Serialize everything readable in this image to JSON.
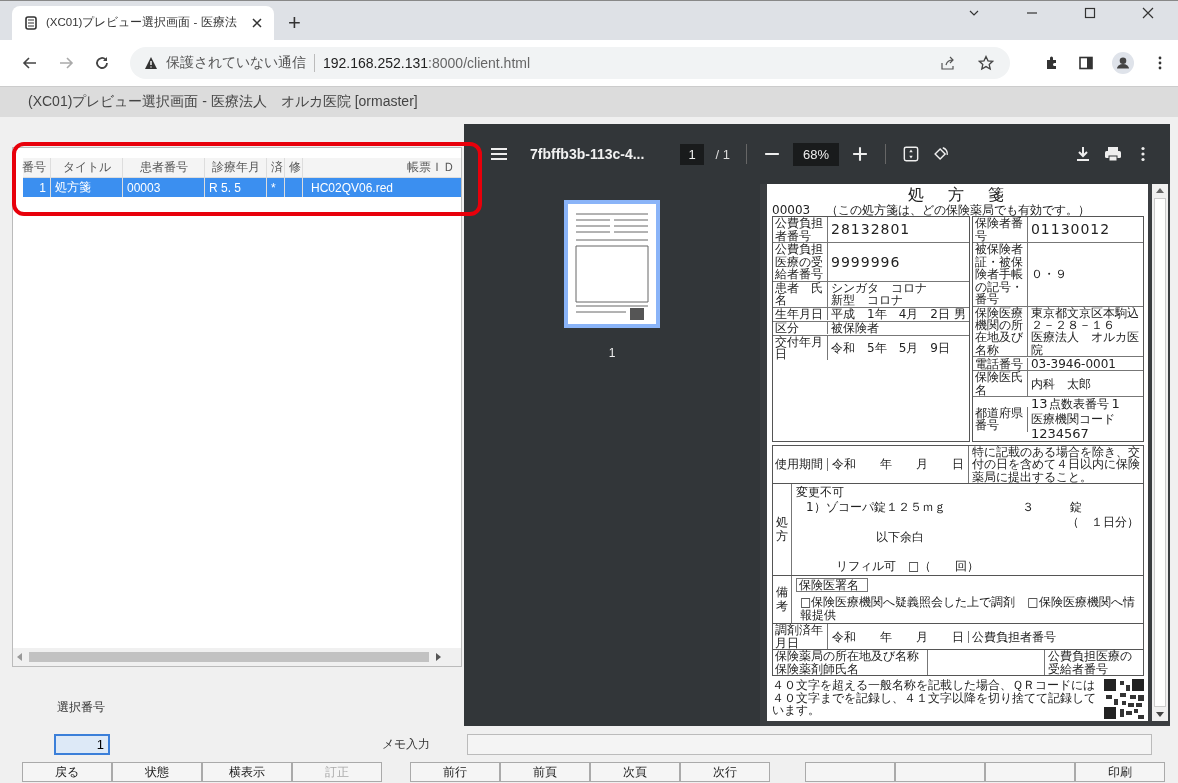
{
  "browser": {
    "tab_title": "(XC01)プレビュー選択画面 - 医療法",
    "new_tab": "+",
    "security_label": "保護されていない通信",
    "url_host": "192.168.252.131",
    "url_rest": ":8000/client.html"
  },
  "app_title": "(XC01)プレビュー選択画面 - 医療法人　オルカ医院 [ormaster]",
  "table": {
    "columns": [
      "番号",
      "タイトル",
      "患者番号",
      "診療年月",
      "済",
      "修",
      "帳票ＩＤ"
    ],
    "rows": [
      {
        "selected": true,
        "cells": [
          "1",
          "処方箋",
          "00003",
          "R 5. 5",
          "*",
          null,
          "HC02QV06.red"
        ]
      }
    ]
  },
  "select_label": "選択番号",
  "select_value": "1",
  "memo_label": "メモ入力",
  "viewer": {
    "file_name": "7fbffb3b-113c-4...",
    "page": "1",
    "page_total": "/ 1",
    "zoom": "68%",
    "thumbnail_label": "1"
  },
  "document": {
    "title": "処　方　箋",
    "patient_code": "00003",
    "note": "（この処方箋は、どの保険薬局でも有効です。）",
    "left_rows": [
      {
        "kind": "digits",
        "label": "公費負担者番号",
        "values": [
          "28132801"
        ]
      },
      {
        "kind": "digits",
        "label": "公費負担医療の受給者番号",
        "values": [
          "9999996"
        ]
      },
      {
        "kind": "text",
        "label": "患者　氏名",
        "values": [
          "シンガタ　コロナ",
          "新型　コロナ"
        ]
      },
      {
        "kind": "inline",
        "label": "生年月日",
        "values": [
          "平成　1年　4月　2日",
          "男"
        ]
      },
      {
        "kind": "text",
        "label": "区分",
        "values": [
          "被保険者"
        ]
      },
      {
        "kind": "text",
        "label": "交付年月日",
        "values": [
          "令和　5年　5月　9日"
        ]
      }
    ],
    "right_rows": [
      {
        "kind": "digits",
        "label": "保険者番号",
        "values": [
          "01130012"
        ]
      },
      {
        "kind": "text",
        "label": "被保険者証・被保険者手帳の記号・番号",
        "values": [
          "０・９"
        ]
      },
      {
        "kind": "text",
        "label": "保険医療機関の所在地及び名称",
        "values": [
          "東京都文京区本駒込２－２８－１６",
          "医療法人　オルカ医院"
        ]
      },
      {
        "kind": "text",
        "label": "電話番号",
        "values": [
          "03-3946-0001"
        ]
      },
      {
        "kind": "text",
        "label": "保険医氏名",
        "values": [
          "内科　太郎"
        ]
      },
      {
        "kind": "codes",
        "label": "都道府県番号",
        "values": [
          "13",
          "点数表番号",
          "1",
          "医療機関コード",
          "1234567"
        ]
      }
    ],
    "usage_label": "使用期間",
    "usage_value": "令和　　年　　月　　日",
    "usage_note": "特に記載のある場合を除き、交付の日を含めて４日以内に保険薬局に提出すること。",
    "rx_label": "処方",
    "rx_change": "変更不可",
    "rx_lines": [
      {
        "drug": "1）ゾコーパ錠１２５ｍｇ",
        "qty": "３",
        "unit": "錠"
      }
    ],
    "rx_days": "（　１日分）",
    "rx_end": "以下余白",
    "rx_refill": "リフィル可　□（　　回）",
    "remarks_label": "備考",
    "signature_label": "保険医署名",
    "remarks_line": "□保険医療機関へ疑義照会した上で調剤　□保険医療機関へ情報提供",
    "dispense_label": "調剤済年月日",
    "dispense_value": "令和　　年　　月　　日",
    "dispense_right": "公費負担者番号",
    "pharmacy_labels": [
      "保険薬局の所在地及び名称",
      "保険薬剤師氏名"
    ],
    "pharmacy_right": "公費負担医療の受給者番号",
    "footer": "４０文字を超える一般名称を記載した場合、ＱＲコードには４０文字までを記録し、４１文字以降を切り捨てて記録しています。"
  },
  "button_groups": [
    [
      {
        "kind": "label",
        "label": "戻る",
        "disabled": false
      },
      {
        "kind": "label",
        "label": "状態",
        "disabled": false
      },
      {
        "kind": "label",
        "label": "横表示",
        "disabled": false
      },
      {
        "kind": "label",
        "label": "訂正",
        "disabled": true
      }
    ],
    [
      {
        "kind": "label",
        "label": "前行",
        "disabled": false
      },
      {
        "kind": "label",
        "label": "前頁",
        "disabled": false
      },
      {
        "kind": "label",
        "label": "次頁",
        "disabled": false
      },
      {
        "kind": "label",
        "label": "次行",
        "disabled": false
      }
    ],
    [
      {
        "kind": "blank"
      },
      {
        "kind": "blank"
      },
      {
        "kind": "blank"
      },
      {
        "kind": "label",
        "label": "印刷",
        "disabled": false
      }
    ]
  ]
}
